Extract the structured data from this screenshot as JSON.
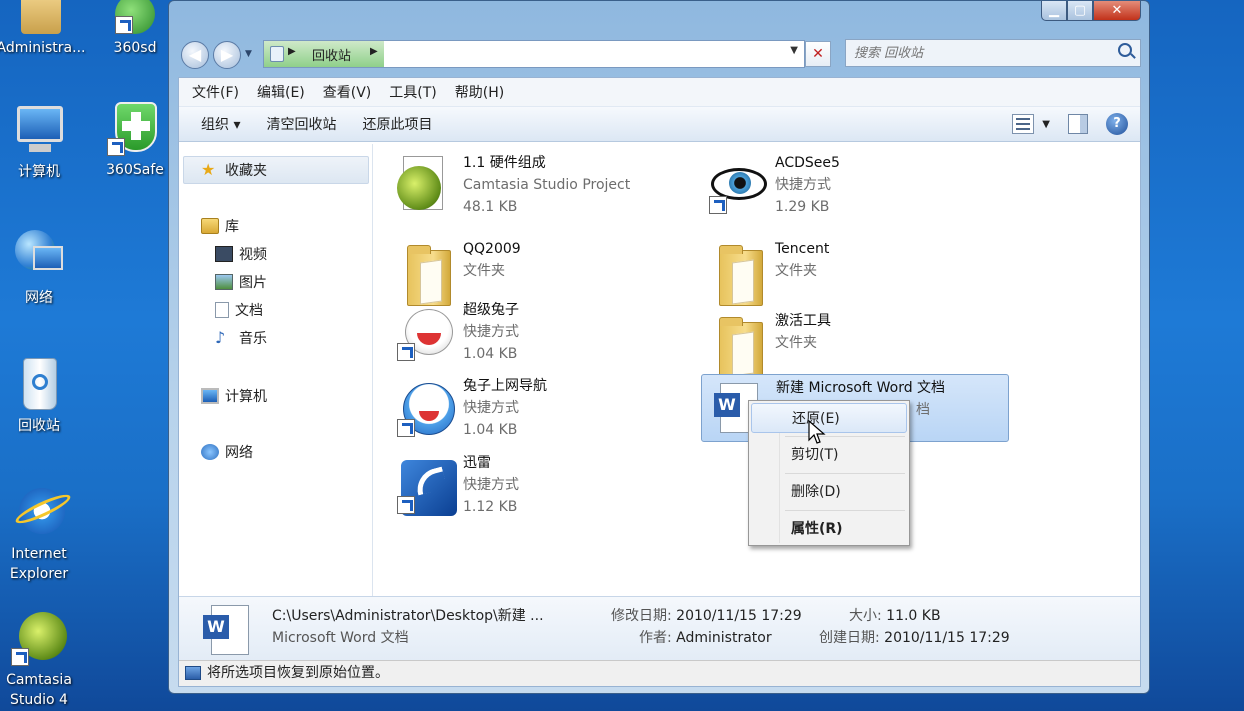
{
  "desktop": {
    "icons": [
      {
        "label": "Administra..."
      },
      {
        "label": "360sd"
      },
      {
        "label": "计算机"
      },
      {
        "label": "360Safe"
      },
      {
        "label": "网络"
      },
      {
        "label": "回收站"
      },
      {
        "label": "Internet Explorer"
      },
      {
        "label": "Camtasia Studio 4"
      }
    ]
  },
  "window": {
    "address": {
      "location": "回收站"
    },
    "search": {
      "placeholder": "搜索 回收站"
    },
    "menu": [
      "文件(F)",
      "编辑(E)",
      "查看(V)",
      "工具(T)",
      "帮助(H)"
    ],
    "commands": {
      "organize": "组织 ▾",
      "empty": "清空回收站",
      "restore": "还原此项目"
    },
    "nav": {
      "favorites": "收藏夹",
      "library": "库",
      "video": "视频",
      "pictures": "图片",
      "documents": "文档",
      "music": "音乐",
      "computer": "计算机",
      "network": "网络"
    },
    "files": [
      {
        "name": "1.1  硬件组成",
        "type": "Camtasia Studio Project",
        "size": "48.1 KB",
        "icon": "camtasia-icon"
      },
      {
        "name": "ACDSee5",
        "type": "快捷方式",
        "size": "1.29 KB",
        "icon": "eye-icon"
      },
      {
        "name": "QQ2009",
        "type": "文件夹",
        "size": "",
        "icon": "folder-icon"
      },
      {
        "name": "Tencent",
        "type": "文件夹",
        "size": "",
        "icon": "folder-icon"
      },
      {
        "name": "超级兔子",
        "type": "快捷方式",
        "size": "1.04 KB",
        "icon": "rabbit-icon"
      },
      {
        "name": "激活工具",
        "type": "文件夹",
        "size": "",
        "icon": "folder-icon"
      },
      {
        "name": "兔子上网导航",
        "type": "快捷方式",
        "size": "1.04 KB",
        "icon": "rabbit-icon"
      },
      {
        "name": "新建 Microsoft Word 文档",
        "type": "档",
        "size": "",
        "icon": "word-icon"
      },
      {
        "name": "迅雷",
        "type": "快捷方式",
        "size": "1.12 KB",
        "icon": "thunder-icon"
      }
    ],
    "context_menu": {
      "restore": "还原(E)",
      "cut": "剪切(T)",
      "delete": "删除(D)",
      "properties": "属性(R)"
    },
    "details": {
      "path": "C:\\Users\\Administrator\\Desktop\\新建 ...",
      "filetype": "Microsoft Word 文档",
      "modified_label": "修改日期:",
      "modified": "2010/11/15 17:29",
      "author_label": "作者:",
      "author": "Administrator",
      "size_label": "大小:",
      "size": "11.0 KB",
      "created_label": "创建日期:",
      "created": "2010/11/15 17:29"
    },
    "status": "将所选项目恢复到原始位置。"
  },
  "colors": {
    "accent": "#1d5fbf",
    "selection": "#c5dcf7",
    "desktop": "#1a6fc7"
  }
}
